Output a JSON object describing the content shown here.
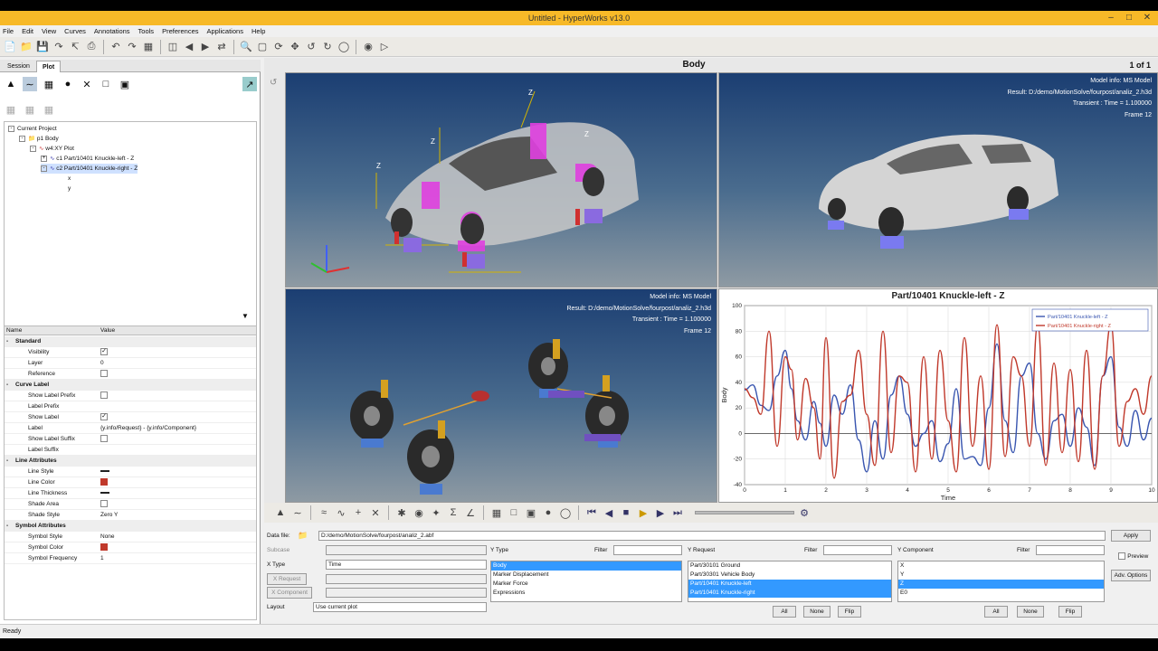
{
  "window": {
    "title": "Untitled - HyperWorks v13.0"
  },
  "menu": [
    "File",
    "Edit",
    "View",
    "Curves",
    "Annotations",
    "Tools",
    "Preferences",
    "Applications",
    "Help"
  ],
  "left": {
    "tabs": [
      "Session",
      "Plot"
    ],
    "tree": {
      "root": "Current Project",
      "page": "p1 Body",
      "window": "w4:XY Plot",
      "curve1": "c1 Part/10401 Knuckle-left - Z",
      "curve2": "c2 Part/10401 Knuckle-right - Z",
      "x": "x",
      "y": "y"
    },
    "props": {
      "col_name": "Name",
      "col_value": "Value",
      "standard": "Standard",
      "visibility": "Visibility",
      "layer": "Layer",
      "layer_value": "0",
      "reference": "Reference",
      "curve_label": "Curve Label",
      "show_label_prefix": "Show Label Prefix",
      "label_prefix": "Label Prefix",
      "show_label": "Show Label",
      "label": "Label",
      "label_value": "{y.info/Request} - {y.info/Component}",
      "show_label_suffix": "Show Label Suffix",
      "label_suffix": "Label Suffix",
      "line_attributes": "Line Attributes",
      "line_style": "Line Style",
      "line_color": "Line Color",
      "line_thickness": "Line Thickness",
      "shade_area": "Shade Area",
      "shade_style": "Shade Style",
      "shade_style_value": "Zero Y",
      "symbol_attributes": "Symbol Attributes",
      "symbol_style": "Symbol Style",
      "symbol_style_value": "None",
      "symbol_color": "Symbol Color",
      "symbol_frequency": "Symbol Frequency",
      "symbol_frequency_value": "1"
    }
  },
  "page": {
    "title": "Body",
    "counter": "1 of 1"
  },
  "panes": {
    "tr": {
      "l1": "Model info: MS Model",
      "l2": "Result: D:/demo/MotionSolve/fourpost/analiz_2.h3d",
      "l3": "Transient : Time = 1.100000",
      "l4": "Frame 12"
    },
    "bl": {
      "l1": "Model info: MS Model",
      "l2": "Result: D:/demo/MotionSolve/fourpost/analiz_2.h3d",
      "l3": "Transient : Time = 1.100000",
      "l4": "Frame 12"
    }
  },
  "axis_labels": {
    "tl_z1": "Z",
    "tl_z2": "Z",
    "tl_z3": "Z",
    "tl_z4": "Z"
  },
  "chart_data": {
    "type": "line",
    "title": "Part/10401 Knuckle-left - Z",
    "xlabel": "Time",
    "ylabel": "Body",
    "xlim": [
      0,
      10
    ],
    "ylim": [
      -40,
      100
    ],
    "xticks": [
      "0",
      "1",
      "2",
      "3",
      "4",
      "5",
      "6",
      "7",
      "8",
      "9",
      "10"
    ],
    "yticks": [
      "-40",
      "-20",
      "0",
      "20",
      "40",
      "60",
      "80",
      "100"
    ],
    "legend": "top-right",
    "grid": true,
    "series": [
      {
        "name": "Part/10401 Knuckle-left - Z",
        "color": "#3a56b0",
        "x": [
          0,
          0.2,
          0.4,
          0.6,
          0.8,
          1.0,
          1.15,
          1.3,
          1.5,
          1.7,
          1.85,
          2.0,
          2.2,
          2.4,
          2.6,
          2.8,
          3.0,
          3.2,
          3.4,
          3.6,
          3.8,
          4.0,
          4.2,
          4.4,
          4.6,
          4.8,
          5.0,
          5.2,
          5.4,
          5.6,
          5.8,
          6.0,
          6.2,
          6.4,
          6.6,
          6.8,
          7.0,
          7.2,
          7.4,
          7.6,
          7.8,
          8.0,
          8.2,
          8.4,
          8.6,
          8.8,
          9.0,
          9.2,
          9.4,
          9.6,
          9.8,
          10.0
        ],
        "values": [
          34,
          38,
          22,
          18,
          45,
          65,
          35,
          10,
          -5,
          25,
          8,
          -10,
          30,
          15,
          38,
          -5,
          -30,
          10,
          -20,
          30,
          45,
          15,
          -10,
          0,
          10,
          -22,
          -8,
          35,
          -20,
          -18,
          -25,
          20,
          70,
          10,
          -15,
          45,
          55,
          0,
          -20,
          10,
          15,
          -10,
          20,
          5,
          -25,
          45,
          60,
          5,
          -10,
          18,
          -5,
          12
        ]
      },
      {
        "name": "Part/10401 Knuckle-right - Z",
        "color": "#c0392b",
        "x": [
          0,
          0.2,
          0.4,
          0.6,
          0.8,
          1.0,
          1.15,
          1.3,
          1.5,
          1.7,
          1.85,
          2.0,
          2.2,
          2.4,
          2.6,
          2.8,
          3.0,
          3.2,
          3.4,
          3.6,
          3.8,
          4.0,
          4.2,
          4.4,
          4.6,
          4.8,
          5.0,
          5.2,
          5.4,
          5.6,
          5.8,
          6.0,
          6.2,
          6.4,
          6.6,
          6.8,
          7.0,
          7.2,
          7.4,
          7.6,
          7.8,
          8.0,
          8.2,
          8.4,
          8.6,
          8.8,
          9.0,
          9.2,
          9.4,
          9.6,
          9.8,
          10.0
        ],
        "values": [
          35,
          28,
          15,
          80,
          -10,
          60,
          50,
          -5,
          43,
          20,
          -20,
          75,
          -35,
          25,
          30,
          65,
          15,
          -25,
          80,
          -15,
          45,
          40,
          -30,
          60,
          -20,
          65,
          10,
          -30,
          75,
          -10,
          45,
          -28,
          85,
          -18,
          60,
          45,
          -10,
          85,
          -25,
          55,
          -15,
          50,
          -22,
          65,
          -28,
          45,
          85,
          -10,
          25,
          35,
          15,
          45
        ]
      }
    ]
  },
  "bottom": {
    "data_file_label": "Data file:",
    "data_file_value": "D:/demo/MotionSolve/fourpost/analiz_2.abf",
    "subcase_label": "Subcase",
    "xtype_label": "X Type",
    "xtype_value": "Time",
    "xrequest_label": "X Request",
    "xcomponent_label": "X Component",
    "layout_label": "Layout",
    "layout_value": "Use current plot",
    "ytype_label": "Y Type",
    "ytype_items": [
      "Body",
      "Marker Displacement",
      "Marker Force",
      "Expressions"
    ],
    "filter_label": "Filter",
    "yrequest_label": "Y Request",
    "yrequest_items": [
      "Part/30101 Ground",
      "Part/30301 Vehicle Body",
      "Part/10401 Knuckle-left",
      "Part/10401 Knuckle-right"
    ],
    "ycomponent_label": "Y Component",
    "ycomponent_items": [
      "X",
      "Y",
      "Z",
      "E0"
    ],
    "all": "All",
    "none": "None",
    "flip": "Flip",
    "apply": "Apply",
    "preview": "Preview",
    "adv_options": "Adv. Options"
  },
  "status": "Ready"
}
